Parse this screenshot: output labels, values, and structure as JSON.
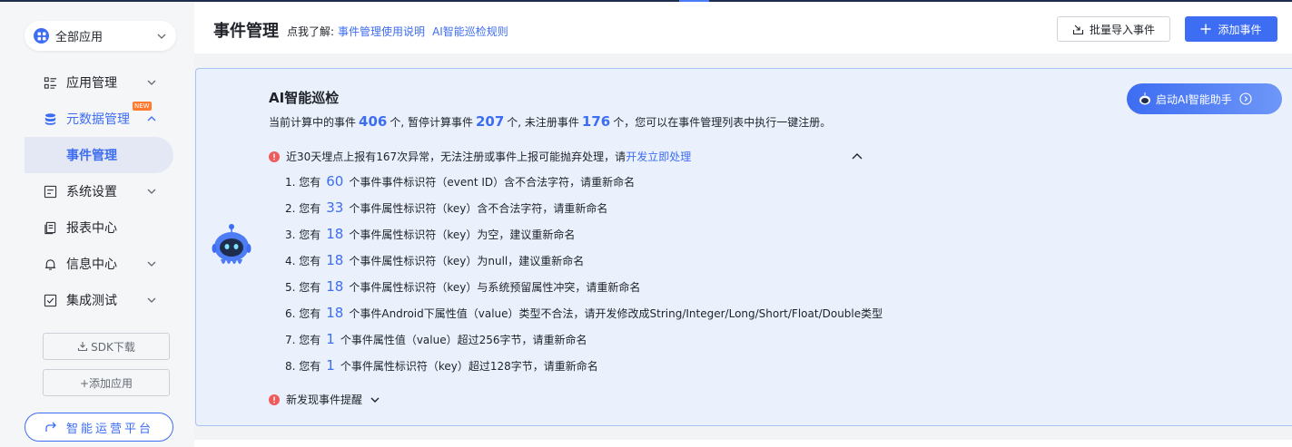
{
  "sidebar": {
    "app_select": "全部应用",
    "items": [
      {
        "label": "应用管理"
      },
      {
        "label": "元数据管理",
        "badge": "NEW"
      },
      {
        "label": "事件管理"
      },
      {
        "label": "系统设置"
      },
      {
        "label": "报表中心"
      },
      {
        "label": "信息中心"
      },
      {
        "label": "集成测试"
      }
    ],
    "sdk_button": "SDK下载",
    "add_app_button": "+添加应用",
    "platform_button": "智能运营平台"
  },
  "header": {
    "title": "事件管理",
    "learn_prefix": "点我了解:",
    "links": [
      "事件管理使用说明",
      "AI智能巡检规则"
    ],
    "import_button": "批量导入事件",
    "add_button": "添加事件"
  },
  "ai_panel": {
    "title": "AI智能巡检",
    "summary": {
      "part1": "当前计算中的事件",
      "computing_count": "406",
      "part2": "个, 暂停计算事件",
      "paused_count": "207",
      "part3": "个, 未注册事件",
      "unregistered_count": "176",
      "part4": "个，您可以在事件管理列表中执行一键注册。"
    },
    "assist_button": "启动AI智能助手",
    "warning": {
      "text": "近30天埋点上报有167次异常，无法注册或事件上报可能抛弃处理，请",
      "link": "开发立即处理"
    },
    "issues": [
      {
        "prefix": "1. 您有",
        "count": "60",
        "text": "个事件事件标识符（event ID）含不合法字符，请重新命名"
      },
      {
        "prefix": "2. 您有",
        "count": "33",
        "text": "个事件属性标识符（key）含不合法字符，请重新命名"
      },
      {
        "prefix": "3. 您有",
        "count": "18",
        "text": "个事件属性标识符（key）为空，建议重新命名"
      },
      {
        "prefix": "4. 您有",
        "count": "18",
        "text": "个事件属性标识符（key）为null，建议重新命名"
      },
      {
        "prefix": "5. 您有",
        "count": "18",
        "text": "个事件属性标识符（key）与系统预留属性冲突，请重新命名"
      },
      {
        "prefix": "6. 您有",
        "count": "18",
        "text": "个事件Android下属性值（value）类型不合法，请开发修改成String/Integer/Long/Short/Float/Double类型"
      },
      {
        "prefix": "7. 您有",
        "count": "1",
        "text": "个事件属性值（value）超过256字节，请重新命名"
      },
      {
        "prefix": "8. 您有",
        "count": "1",
        "text": "个事件属性标识符（key）超过128字节，请重新命名"
      }
    ],
    "new_events": "新发现事件提醒"
  },
  "colors": {
    "accent": "#3d6df2",
    "panel_bg": "#eaf0fc",
    "warning": "#f05a5a"
  }
}
